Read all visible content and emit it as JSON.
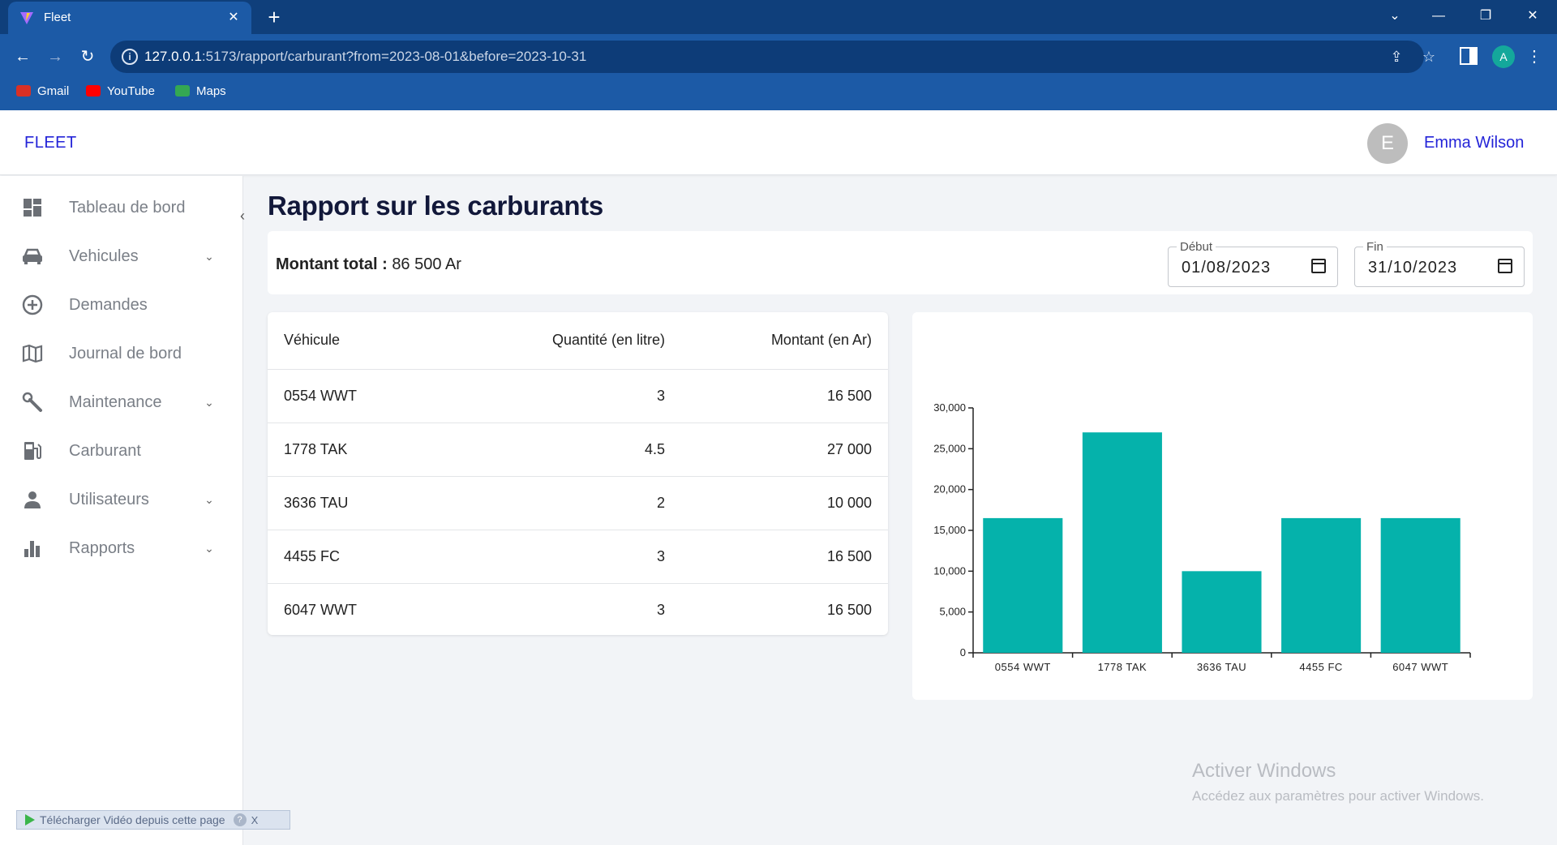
{
  "browser": {
    "tab_title": "Fleet",
    "url_host": "127.0.0.1",
    "url_rest": ":5173/rapport/carburant?from=2023-08-01&before=2023-10-31",
    "profile_initial": "A",
    "bookmarks": [
      {
        "label": "Gmail",
        "color": "#d93025"
      },
      {
        "label": "YouTube",
        "color": "#ff0000"
      },
      {
        "label": "Maps",
        "color": "#34a853"
      }
    ]
  },
  "app": {
    "brand": "FLEET",
    "user_initial": "E",
    "user_name": "Emma Wilson"
  },
  "sidebar": {
    "items": [
      {
        "label": "Tableau de bord",
        "icon": "dashboard-icon",
        "has_chevron": false
      },
      {
        "label": "Vehicules",
        "icon": "car-icon",
        "has_chevron": true
      },
      {
        "label": "Demandes",
        "icon": "add-circle-icon",
        "has_chevron": false
      },
      {
        "label": "Journal de bord",
        "icon": "map-icon",
        "has_chevron": false
      },
      {
        "label": "Maintenance",
        "icon": "wrench-icon",
        "has_chevron": true
      },
      {
        "label": "Carburant",
        "icon": "fuel-icon",
        "has_chevron": false
      },
      {
        "label": "Utilisateurs",
        "icon": "person-icon",
        "has_chevron": true
      },
      {
        "label": "Rapports",
        "icon": "bar-chart-icon",
        "has_chevron": true
      }
    ]
  },
  "page": {
    "title": "Rapport sur les carburants",
    "total_label": "Montant total :",
    "total_value": "86 500 Ar",
    "start_label": "Début",
    "start_value": "01/08/2023",
    "end_label": "Fin",
    "end_value": "31/10/2023"
  },
  "table": {
    "headers": [
      "Véhicule",
      "Quantité (en litre)",
      "Montant (en Ar)"
    ],
    "rows": [
      [
        "0554 WWT",
        "3",
        "16 500"
      ],
      [
        "1778 TAK",
        "4.5",
        "27 000"
      ],
      [
        "3636 TAU",
        "2",
        "10 000"
      ],
      [
        "4455 FC",
        "3",
        "16 500"
      ],
      [
        "6047 WWT",
        "3",
        "16 500"
      ]
    ]
  },
  "chart_data": {
    "type": "bar",
    "categories": [
      "0554 WWT",
      "1778 TAK",
      "3636 TAU",
      "4455 FC",
      "6047 WWT"
    ],
    "values": [
      16500,
      27000,
      10000,
      16500,
      16500
    ],
    "ylim": [
      0,
      30000
    ],
    "yticks": [
      "0",
      "5,000",
      "10,000",
      "15,000",
      "20,000",
      "25,000",
      "30,000"
    ],
    "bar_color": "#05b2ab",
    "grid": false,
    "title": "",
    "xlabel": "",
    "ylabel": ""
  },
  "overlays": {
    "watermark_title": "Activer Windows",
    "watermark_sub": "Accédez aux paramètres pour activer Windows.",
    "extension_text": "Télécharger Vidéo depuis cette page",
    "extension_help": "?",
    "extension_close": "X"
  }
}
